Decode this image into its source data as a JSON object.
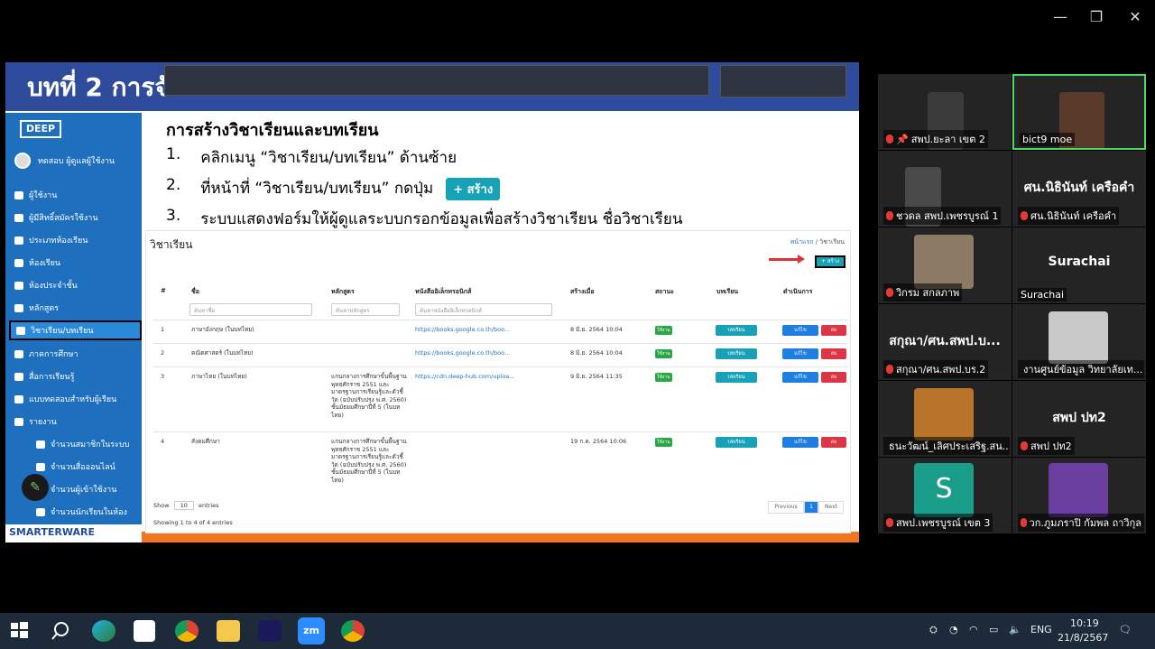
{
  "window": {
    "minimize": "—",
    "restore": "❐",
    "close": "✕"
  },
  "slide": {
    "banner_title": "บทที่ 2 การจั",
    "heading": "การสร้างวิชาเรียนและบทเรียน",
    "steps": [
      {
        "num": "1.",
        "text": "คลิกเมนู “วิชาเรียน/บทเรียน” ด้านซ้าย"
      },
      {
        "num": "2.",
        "text": "ที่หน้าที่ “วิชาเรียน/บทเรียน” กดปุ่ม"
      },
      {
        "num": "3.",
        "text": "ระบบแสดงฟอร์มให้ผู้ดูแลระบบกรอกข้อมูลเพื่อสร้างวิชาเรียน ชื่อวิชาเรียน"
      }
    ],
    "create_button": "+ สร้าง"
  },
  "app": {
    "logo": "DEEP",
    "user": "ทดสอบ ผู้ดูแลผู้ใช้งาน",
    "nav": [
      "ผู้ใช้งาน",
      "ผู้มีสิทธิ์สมัครใช้งาน",
      "ประเภทห้องเรียน",
      "ห้องเรียน",
      "ห้องประจำชั้น",
      "หลักสูตร",
      "วิชาเรียน/บทเรียน",
      "ภาคการศึกษา",
      "สื่อการเรียนรู้",
      "แบบทดสอบสำหรับผู้เรียน",
      "รายงาน"
    ],
    "subnav": [
      "จำนวนสมาชิกในระบบ",
      "จำนวนสื่อออนไลน์",
      "จำนวนผู้เข้าใช้งาน",
      "จำนวนนักเรียนในห้อง"
    ],
    "smarterware": "SMARTERWARE",
    "page_title": "วิชาเรียน",
    "breadcrumb_home": "หน้าแรก",
    "breadcrumb_sep": "/",
    "breadcrumb_current": "วิชาเรียน",
    "create_small": "+ สร้าง",
    "columns": [
      "#",
      "ชื่อ",
      "หลักสูตร",
      "หนังสืออิเล็กทรอนิกส์",
      "สร้างเมื่อ",
      "สถานะ",
      "บทเรียน",
      "ดำเนินการ"
    ],
    "filters": {
      "name": "ค้นหาชื่อ",
      "curriculum": "ค้นหาหลักสูตร",
      "ebook": "ค้นหาหนังสืออิเล็กทรอนิกส์"
    },
    "rows": [
      {
        "no": "1",
        "name": "ภาษาอังกฤษ (ในบทไทย)",
        "curriculum": "",
        "ebook": "https://books.google.co.th/boo...",
        "created": "8 มิ.ย. 2564 10:04",
        "status": "ใช้งาน"
      },
      {
        "no": "2",
        "name": "คณิตศาสตร์ (ในบทไทย)",
        "curriculum": "",
        "ebook": "https://books.google.co.th/boo...",
        "created": "8 มิ.ย. 2564 10:04",
        "status": "ใช้งาน"
      },
      {
        "no": "3",
        "name": "ภาษาไทย (ในบทไทย)",
        "curriculum": "แกนกลางการศึกษาขั้นพื้นฐาน พุทธศักราช 2551 และมาตรฐานการเรียนรู้และตัวชี้วัด (ฉบับปรับปรุง พ.ศ. 2560) ชั้นมัธยมศึกษาปีที่ 5 (ในบทไทย)",
        "ebook": "https://cdn.deep-hub.com/uploa...",
        "created": "9 มิ.ย. 2564 11:35",
        "status": "ใช้งาน"
      },
      {
        "no": "4",
        "name": "สังคมศึกษา",
        "curriculum": "แกนกลางการศึกษาขั้นพื้นฐาน พุทธศักราช 2551 และมาตรฐานการเรียนรู้และตัวชี้วัด (ฉบับปรับปรุง พ.ศ. 2560) ชั้นมัธยมศึกษาปีที่ 5 (ในบทไทย)",
        "ebook": "",
        "created": "19 ก.ค. 2564 10:06",
        "status": "ใช้งาน"
      }
    ],
    "lesson_btn": "บทเรียน",
    "edit_btn": "แก้ไข",
    "delete_btn": "ลบ",
    "show_label": "Show",
    "show_value": "10",
    "entries_label": "entries",
    "showing": "Showing 1 to 4 of 4 entries",
    "previous": "Previous",
    "page": "1",
    "next": "Next"
  },
  "participants": [
    {
      "name": "สพป.ยะลา เขต 2",
      "pinned": true,
      "muted": true,
      "video": true
    },
    {
      "name": "bict9 moe",
      "muted": false,
      "video": true,
      "speaking": true
    },
    {
      "name": "ชวดล สพป.เพชรบูรณ์ 1",
      "muted": true,
      "video": true
    },
    {
      "name": "ศน.นิธินันท์ เครือคำ",
      "display": "ศน.นิธินันท์ เครือคำ",
      "muted": true,
      "video": false
    },
    {
      "name": "วิกรม สกลภาพ",
      "muted": true,
      "video": true
    },
    {
      "name": "Surachai",
      "display": "Surachai",
      "muted": false,
      "video": false
    },
    {
      "name": "สกุณา/ศน.สพป.บร.2",
      "display": "สกุณา/ศน.สพป.บ...",
      "muted": true,
      "video": false
    },
    {
      "name": "งานศูนย์ข้อมูล วิทยาลัยเท...",
      "muted": true,
      "video": true
    },
    {
      "name": "ธนะวัฒน์_เลิศประเสริฐ.สน....",
      "muted": true,
      "video": true
    },
    {
      "name": "สพป ปท2",
      "display": "สพป ปท2",
      "muted": true,
      "video": false
    },
    {
      "name": "สพป.เพชรบูรณ์ เขต 3",
      "initial": "S",
      "muted": true,
      "video": false
    },
    {
      "name": "วก.ภูมภราปิ กัมพล ถาวิกุล",
      "muted": true,
      "video": true
    }
  ],
  "taskbar": {
    "zoom_label": "zm",
    "language": "ENG",
    "time": "10:19",
    "date": "21/8/2567"
  }
}
